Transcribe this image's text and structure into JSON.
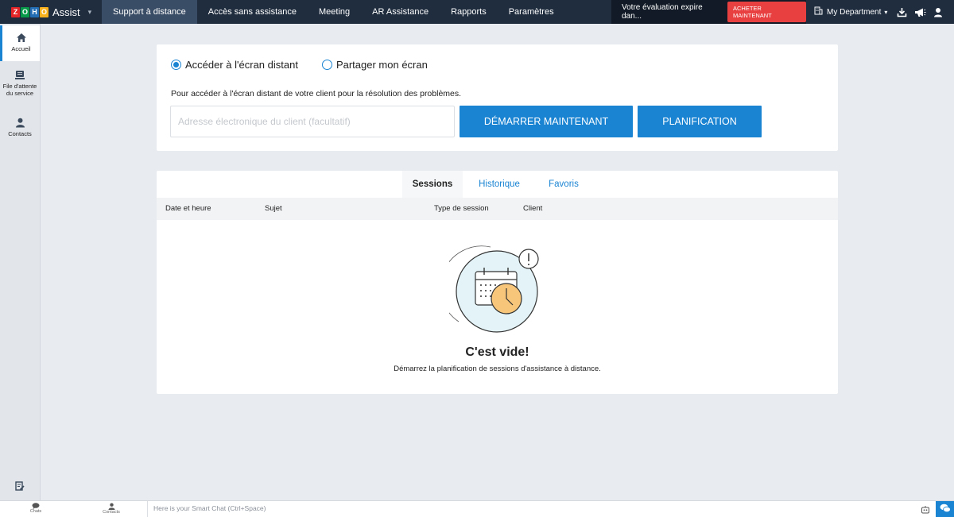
{
  "app": {
    "brand_letters": [
      "Z",
      "O",
      "H",
      "O"
    ],
    "brand_colors": [
      "#e42527",
      "#089949",
      "#226db4",
      "#f9b21d"
    ],
    "name": "Assist"
  },
  "nav": {
    "items": [
      {
        "label": "Support à distance",
        "active": true
      },
      {
        "label": "Accès sans assistance"
      },
      {
        "label": "Meeting"
      },
      {
        "label": "AR Assistance"
      },
      {
        "label": "Rapports"
      },
      {
        "label": "Paramètres"
      }
    ]
  },
  "trial": {
    "text": "Votre évaluation expire dan...",
    "buy_label": "ACHETER MAINTENANT"
  },
  "department": {
    "label": "My Department"
  },
  "top_icons": [
    "download-icon",
    "megaphone-icon",
    "user-icon"
  ],
  "sidebar": {
    "items": [
      {
        "label": "Accueil",
        "icon": "home-icon",
        "active": true
      },
      {
        "label_line1": "File d'attente",
        "label_line2": "du service",
        "icon": "queue-icon"
      },
      {
        "label": "Contacts",
        "icon": "contacts-icon"
      }
    ],
    "bottom_icon": "notes-icon"
  },
  "session": {
    "radio_remote": "Accéder à l'écran distant",
    "radio_share": "Partager mon écran",
    "selected": "remote",
    "description": "Pour accéder à l'écran distant de votre client pour la résolution des problèmes.",
    "email_placeholder": "Adresse électronique du client (facultatif)",
    "email_value": "",
    "start_label": "DÉMARRER MAINTENANT",
    "plan_label": "PLANIFICATION"
  },
  "tabs": {
    "items": [
      "Sessions",
      "Historique",
      "Favoris"
    ],
    "active": "Sessions"
  },
  "table": {
    "columns": [
      "Date et heure",
      "Sujet",
      "Type de session",
      "Client"
    ]
  },
  "empty": {
    "title": "C'est vide!",
    "subtitle": "Démarrez la planification de sessions d'assistance à distance."
  },
  "bottombar": {
    "chats_label": "Chats",
    "contacts_label": "Contacts",
    "smartchat_placeholder": "Here is your Smart Chat (Ctrl+Space)"
  },
  "colors": {
    "accent": "#1a84d3",
    "topbar": "#1f2d3f",
    "buy_button": "#e84040",
    "illustration_fill": "#e3f3f7",
    "clock_fill": "#f7c67a"
  }
}
